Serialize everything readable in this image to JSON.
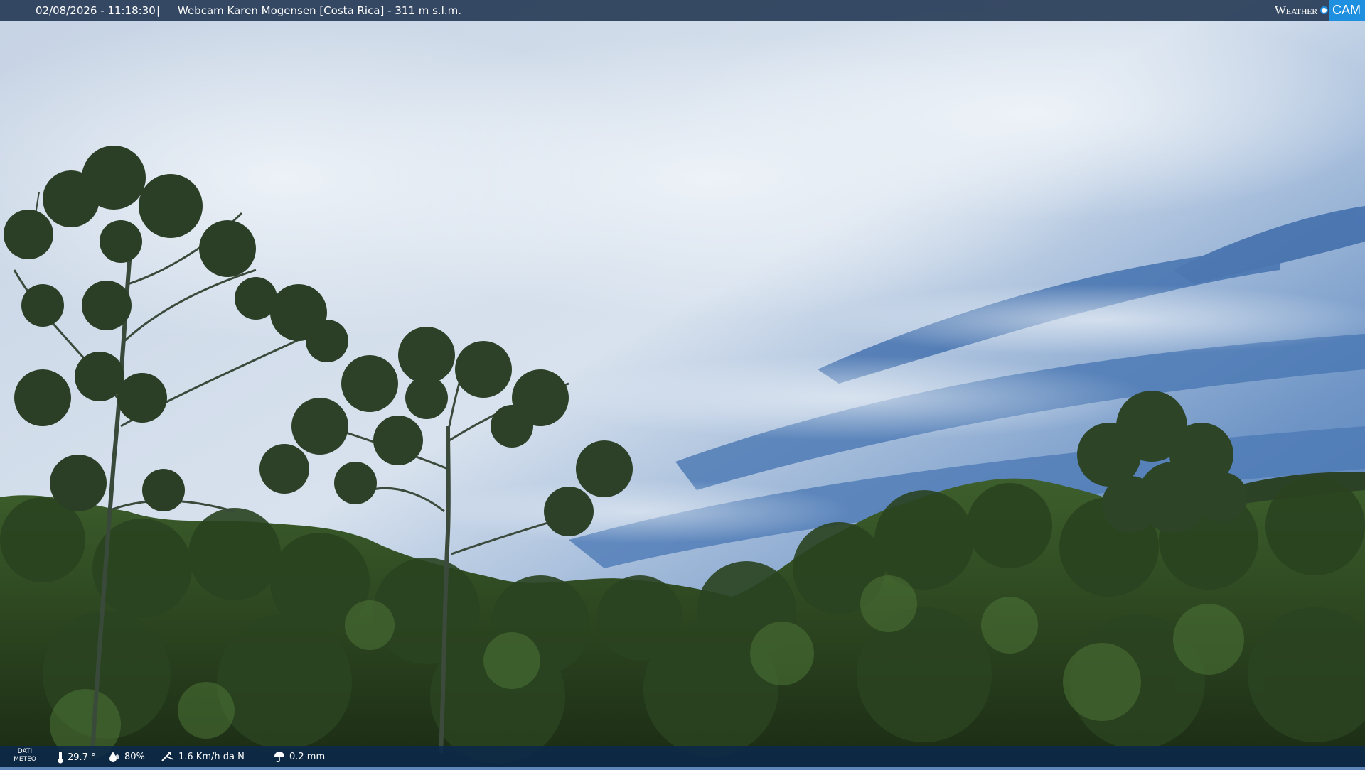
{
  "header": {
    "datetime": "02/08/2026 - 11:18:30",
    "separator": "|",
    "camera_title": "Webcam Karen Mogensen [Costa Rica] - 311 m s.l.m.",
    "logo_left": "Weather",
    "logo_right": "CAM"
  },
  "footer": {
    "label_line1": "DATI",
    "label_line2": "METEO",
    "temperature": "29.7 °",
    "humidity": "80%",
    "wind": "1.6 Km/h da N",
    "rain": "0.2 mm"
  },
  "icons": {
    "temperature": "thermometer-icon",
    "humidity": "humidity-drop-icon",
    "wind": "wind-icon",
    "rain": "rain-umbrella-icon"
  },
  "colors": {
    "sky_top": "#c9d6e6",
    "sky_blue": "#4f7db8",
    "foliage_dark": "#1d2e17",
    "foliage_mid": "#3a5a2a",
    "bar_bg": "#142846",
    "logo_accent": "#1f8fe0"
  }
}
